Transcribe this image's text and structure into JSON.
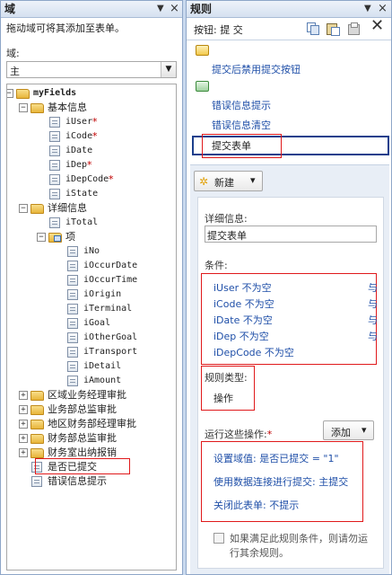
{
  "left_panel": {
    "title": "域",
    "controls": {
      "dropdown": "▼",
      "close": "×"
    },
    "hint": "拖动域可将其添加至表单。",
    "domain_label": "域:",
    "domain_value": "主",
    "tree": [
      {
        "label": "myFields",
        "type": "folder",
        "level": 0,
        "expander": "−"
      },
      {
        "label": "基本信息",
        "type": "folder",
        "level": 1,
        "expander": "−"
      },
      {
        "label": "iUser",
        "type": "field",
        "level": 2,
        "required": "*"
      },
      {
        "label": "iCode",
        "type": "field",
        "level": 2,
        "required": "*"
      },
      {
        "label": "iDate",
        "type": "field",
        "level": 2,
        "required": ""
      },
      {
        "label": "iDep",
        "type": "field",
        "level": 2,
        "required": "*"
      },
      {
        "label": "iDepCode",
        "type": "field",
        "level": 2,
        "required": "*"
      },
      {
        "label": "iState",
        "type": "field",
        "level": 2,
        "required": ""
      },
      {
        "label": "详细信息",
        "type": "folder",
        "level": 1,
        "expander": "−"
      },
      {
        "label": "iTotal",
        "type": "field",
        "level": 2,
        "required": ""
      },
      {
        "label": "项",
        "type": "repeating",
        "level": 2,
        "expander": "−"
      },
      {
        "label": "iNo",
        "type": "field",
        "level": 3,
        "required": ""
      },
      {
        "label": "iOccurDate",
        "type": "field",
        "level": 3,
        "required": ""
      },
      {
        "label": "iOccurTime",
        "type": "field",
        "level": 3,
        "required": ""
      },
      {
        "label": "iOrigin",
        "type": "field",
        "level": 3,
        "required": ""
      },
      {
        "label": "iTerminal",
        "type": "field",
        "level": 3,
        "required": ""
      },
      {
        "label": "iGoal",
        "type": "field",
        "level": 3,
        "required": ""
      },
      {
        "label": "iOtherGoal",
        "type": "field",
        "level": 3,
        "required": ""
      },
      {
        "label": "iTransport",
        "type": "field",
        "level": 3,
        "required": ""
      },
      {
        "label": "iDetail",
        "type": "field",
        "level": 3,
        "required": ""
      },
      {
        "label": "iAmount",
        "type": "field",
        "level": 3,
        "required": ""
      },
      {
        "label": "区域业务经理审批",
        "type": "folder",
        "level": 1,
        "expander": "+"
      },
      {
        "label": "业务部总监审批",
        "type": "folder",
        "level": 1,
        "expander": "+"
      },
      {
        "label": "地区财务部经理审批",
        "type": "folder",
        "level": 1,
        "expander": "+"
      },
      {
        "label": "财务部总监审批",
        "type": "folder",
        "level": 1,
        "expander": "+"
      },
      {
        "label": "财务室出纳报销",
        "type": "folder",
        "level": 1,
        "expander": "+"
      },
      {
        "label": "是否已提交",
        "type": "field",
        "level": 1,
        "required": ""
      },
      {
        "label": "错误信息提示",
        "type": "field",
        "level": 1,
        "required": ""
      }
    ]
  },
  "right_panel": {
    "title": "规则",
    "controls": {
      "dropdown": "▼",
      "close": "×"
    },
    "button_label": "按钮: 提 交",
    "toolbar_icons": [
      "copy-icon",
      "paste-icon",
      "rule-inspector-icon"
    ],
    "rules_list": [
      {
        "label": "提交后禁用提交按钮",
        "group": 1
      },
      {
        "label": "错误信息提示",
        "group": 2
      },
      {
        "label": "错误信息清空",
        "group": 2
      },
      {
        "label": "提交表单",
        "group": 2,
        "selected": true
      }
    ],
    "new_button": "新建",
    "new_arrow": "▾",
    "details_label": "详细信息:",
    "details_value": "提交表单",
    "condition_label": "条件:",
    "conditions": [
      {
        "text": "iUser 不为空",
        "op": "与"
      },
      {
        "text": "iCode 不为空",
        "op": "与"
      },
      {
        "text": "iDate 不为空",
        "op": "与"
      },
      {
        "text": "iDep 不为空",
        "op": "与"
      },
      {
        "text": "iDepCode 不为空",
        "op": ""
      }
    ],
    "rule_type_label": "规则类型:",
    "rule_type_value": "操作",
    "run_actions_label": "运行这些操作:",
    "run_actions_required": "*",
    "add_button": "添加",
    "add_arrow": "▾",
    "actions": [
      "设置域值: 是否已提交 = \"1\"",
      "使用数据连接进行提交: 主提交",
      "关闭此表单: 不提示"
    ],
    "stop_checkbox_label_1": "如果满足此规则条件，则请勿运",
    "stop_checkbox_label_2": "行其余规则。"
  },
  "colors": {
    "highlight_red": "#e0191b",
    "selection_border": "#1c3f8c",
    "link_blue": "#1f4fa8"
  }
}
